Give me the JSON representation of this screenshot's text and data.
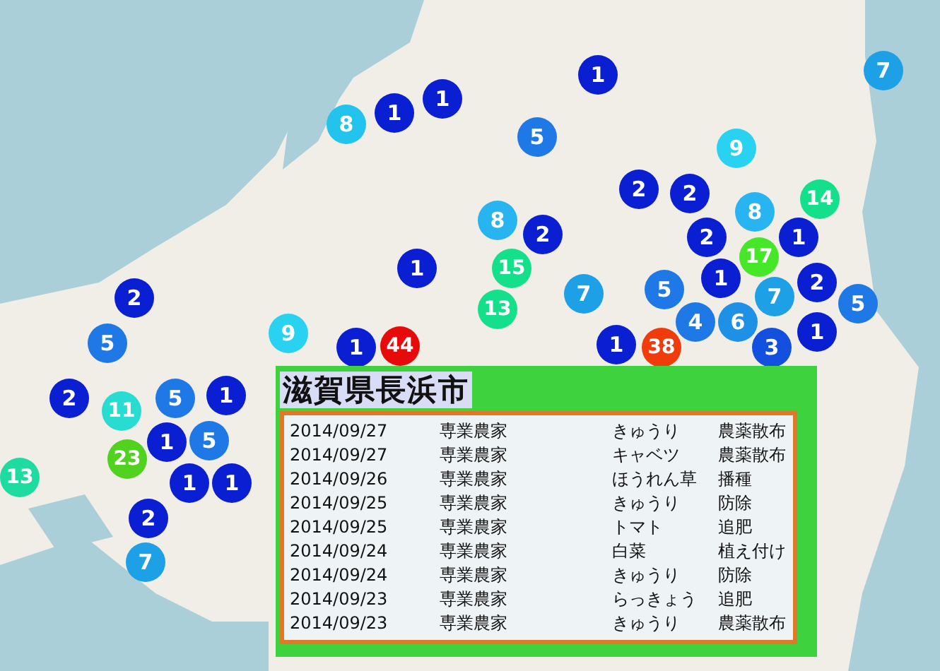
{
  "map": {
    "markers": [
      {
        "count": "7",
        "color": "#1ea0e6"
      },
      {
        "count": "1",
        "color": "#0a1ed2"
      },
      {
        "count": "1",
        "color": "#0a1ed2"
      },
      {
        "count": "1",
        "color": "#0a1ed2"
      },
      {
        "count": "8",
        "color": "#22c4ee"
      },
      {
        "count": "5",
        "color": "#1e78e6"
      },
      {
        "count": "9",
        "color": "#28d2f0"
      },
      {
        "count": "2",
        "color": "#0a1ed2"
      },
      {
        "count": "2",
        "color": "#0a1ed2"
      },
      {
        "count": "14",
        "color": "#14e08c"
      },
      {
        "count": "8",
        "color": "#28b4f0"
      },
      {
        "count": "8",
        "color": "#28b4f0"
      },
      {
        "count": "2",
        "color": "#0a1ed2"
      },
      {
        "count": "2",
        "color": "#0a1ed2"
      },
      {
        "count": "1",
        "color": "#0a1ed2"
      },
      {
        "count": "17",
        "color": "#46e628"
      },
      {
        "count": "1",
        "color": "#0a1ed2"
      },
      {
        "count": "15",
        "color": "#14e08c"
      },
      {
        "count": "1",
        "color": "#0a1ed2"
      },
      {
        "count": "2",
        "color": "#0a1ed2"
      },
      {
        "count": "13",
        "color": "#14e08c"
      },
      {
        "count": "7",
        "color": "#1ea0e6"
      },
      {
        "count": "5",
        "color": "#1e78e6"
      },
      {
        "count": "7",
        "color": "#1ea0e6"
      },
      {
        "count": "2",
        "color": "#0a1ed2"
      },
      {
        "count": "5",
        "color": "#1e78e6"
      },
      {
        "count": "4",
        "color": "#1e78e6"
      },
      {
        "count": "6",
        "color": "#1e90e6"
      },
      {
        "count": "5",
        "color": "#1e78e6"
      },
      {
        "count": "9",
        "color": "#28d2f0"
      },
      {
        "count": "1",
        "color": "#0a1ed2"
      },
      {
        "count": "44",
        "color": "#e60a0a"
      },
      {
        "count": "1",
        "color": "#0a1ed2"
      },
      {
        "count": "38",
        "color": "#f03c0a"
      },
      {
        "count": "3",
        "color": "#1450e0"
      },
      {
        "count": "1",
        "color": "#0a1ed2"
      },
      {
        "count": "2",
        "color": "#0a1ed2"
      },
      {
        "count": "5",
        "color": "#1e78e6"
      },
      {
        "count": "1",
        "color": "#0a1ed2"
      },
      {
        "count": "11",
        "color": "#28dcd2"
      },
      {
        "count": "1",
        "color": "#0a1ed2"
      },
      {
        "count": "5",
        "color": "#1e78e6"
      },
      {
        "count": "23",
        "color": "#50d21e"
      },
      {
        "count": "13",
        "color": "#1edca0"
      },
      {
        "count": "1",
        "color": "#0a1ed2"
      },
      {
        "count": "1",
        "color": "#0a1ed2"
      },
      {
        "count": "2",
        "color": "#0a1ed2"
      },
      {
        "count": "7",
        "color": "#1ea0e6"
      }
    ]
  },
  "popup": {
    "title": "滋賀県長浜市",
    "rows": [
      {
        "date": "2014/09/27",
        "farmer_type": "専業農家",
        "crop": "きゅうり",
        "work": "農薬散布"
      },
      {
        "date": "2014/09/27",
        "farmer_type": "専業農家",
        "crop": "キャベツ",
        "work": "農薬散布"
      },
      {
        "date": "2014/09/26",
        "farmer_type": "専業農家",
        "crop": "ほうれん草",
        "work": "播種"
      },
      {
        "date": "2014/09/25",
        "farmer_type": "専業農家",
        "crop": "きゅうり",
        "work": "防除"
      },
      {
        "date": "2014/09/25",
        "farmer_type": "専業農家",
        "crop": "トマト",
        "work": "追肥"
      },
      {
        "date": "2014/09/24",
        "farmer_type": "専業農家",
        "crop": "白菜",
        "work": "植え付け"
      },
      {
        "date": "2014/09/24",
        "farmer_type": "専業農家",
        "crop": "きゅうり",
        "work": "防除"
      },
      {
        "date": "2014/09/23",
        "farmer_type": "専業農家",
        "crop": "らっきょう",
        "work": "追肥"
      },
      {
        "date": "2014/09/23",
        "farmer_type": "専業農家",
        "crop": "きゅうり",
        "work": "農薬散布"
      }
    ]
  }
}
